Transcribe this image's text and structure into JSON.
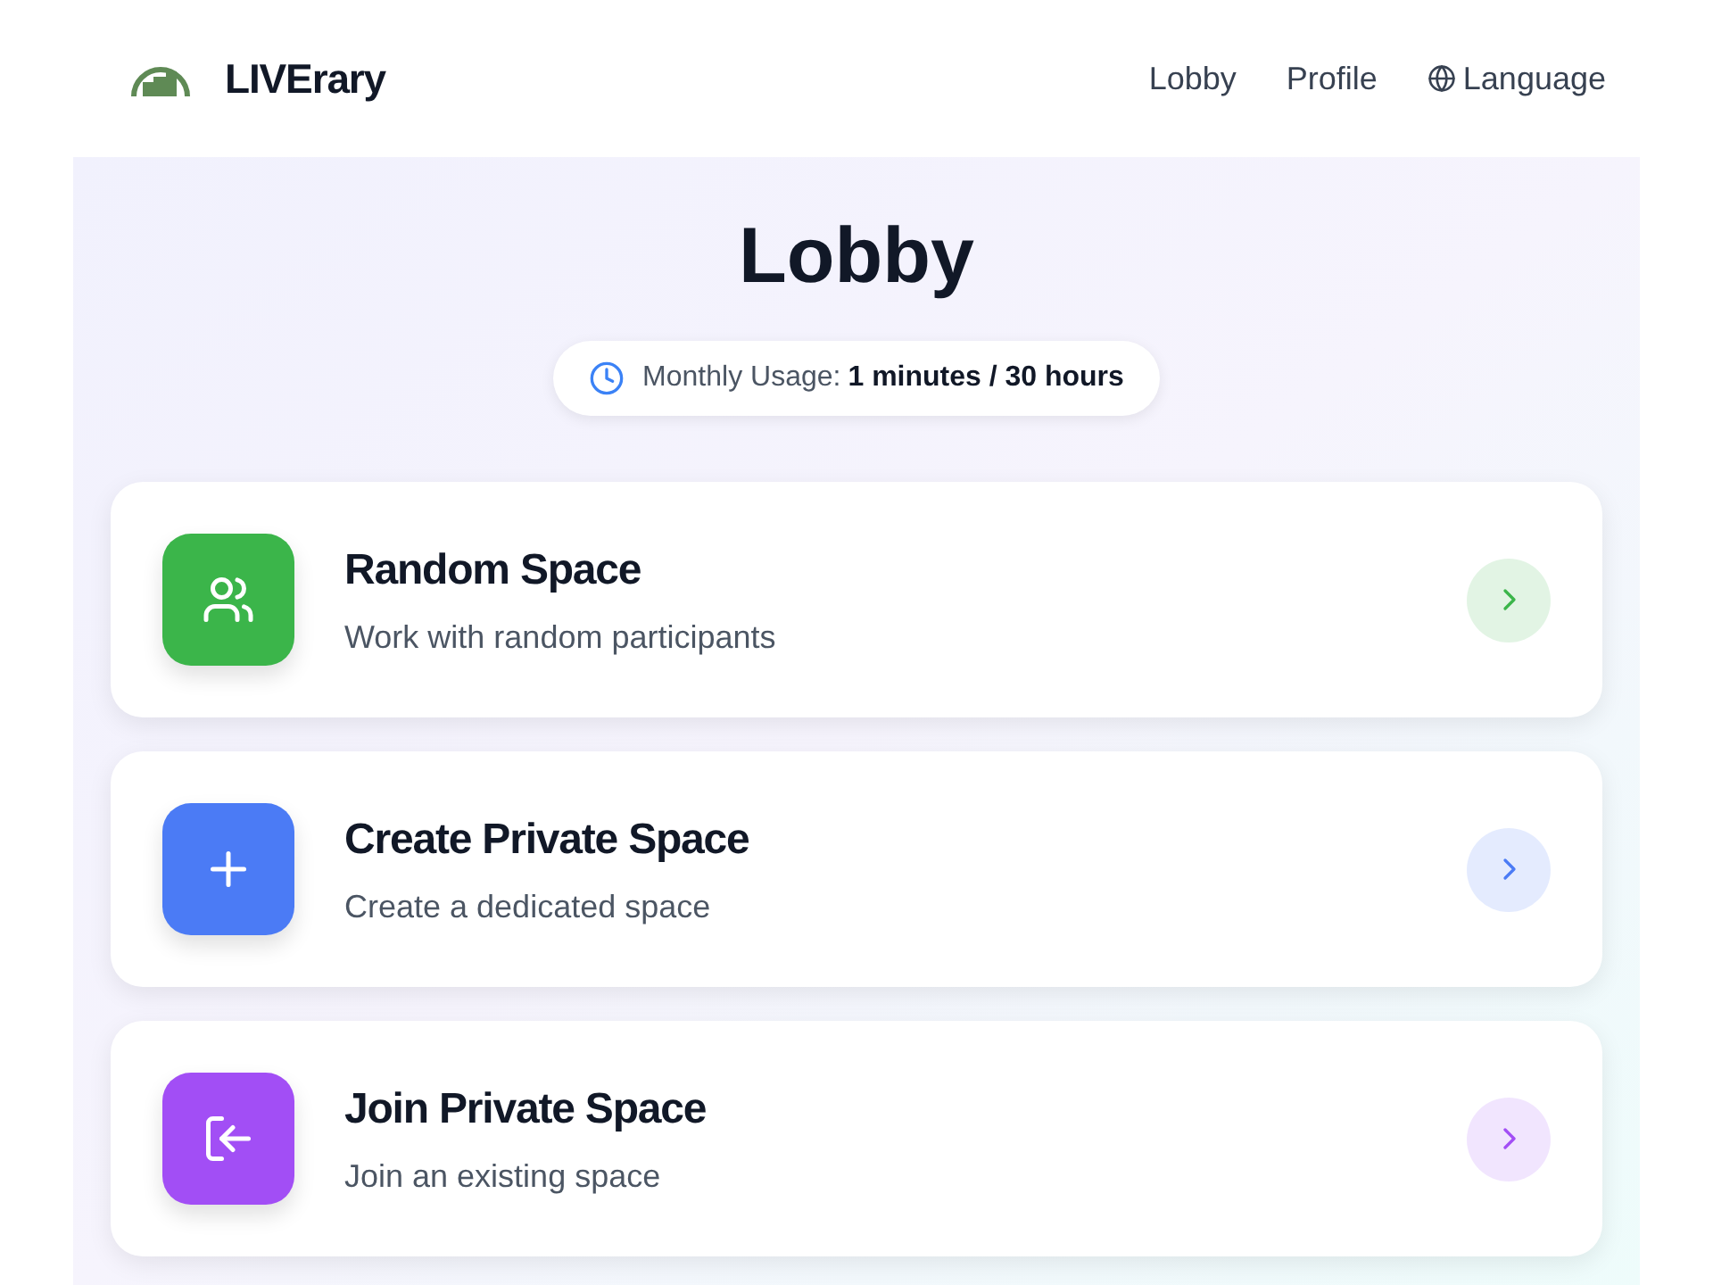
{
  "header": {
    "brand": "LIVErary",
    "nav": [
      {
        "label": "Lobby",
        "kind": "link"
      },
      {
        "label": "Profile",
        "kind": "link"
      },
      {
        "label": "Language",
        "kind": "language"
      }
    ]
  },
  "page": {
    "title": "Lobby",
    "usage": {
      "label": "Monthly Usage:",
      "value": "1 minutes / 30 hours"
    }
  },
  "options": [
    {
      "title": "Random Space",
      "subtitle": "Work with random participants",
      "kind": "people",
      "color": "#3bb54a"
    },
    {
      "title": "Create Private Space",
      "subtitle": "Create a dedicated space",
      "kind": "plus",
      "color": "#4b7bf5"
    },
    {
      "title": "Join Private Space",
      "subtitle": "Join an existing space",
      "kind": "join",
      "color": "#a24ef5"
    }
  ]
}
